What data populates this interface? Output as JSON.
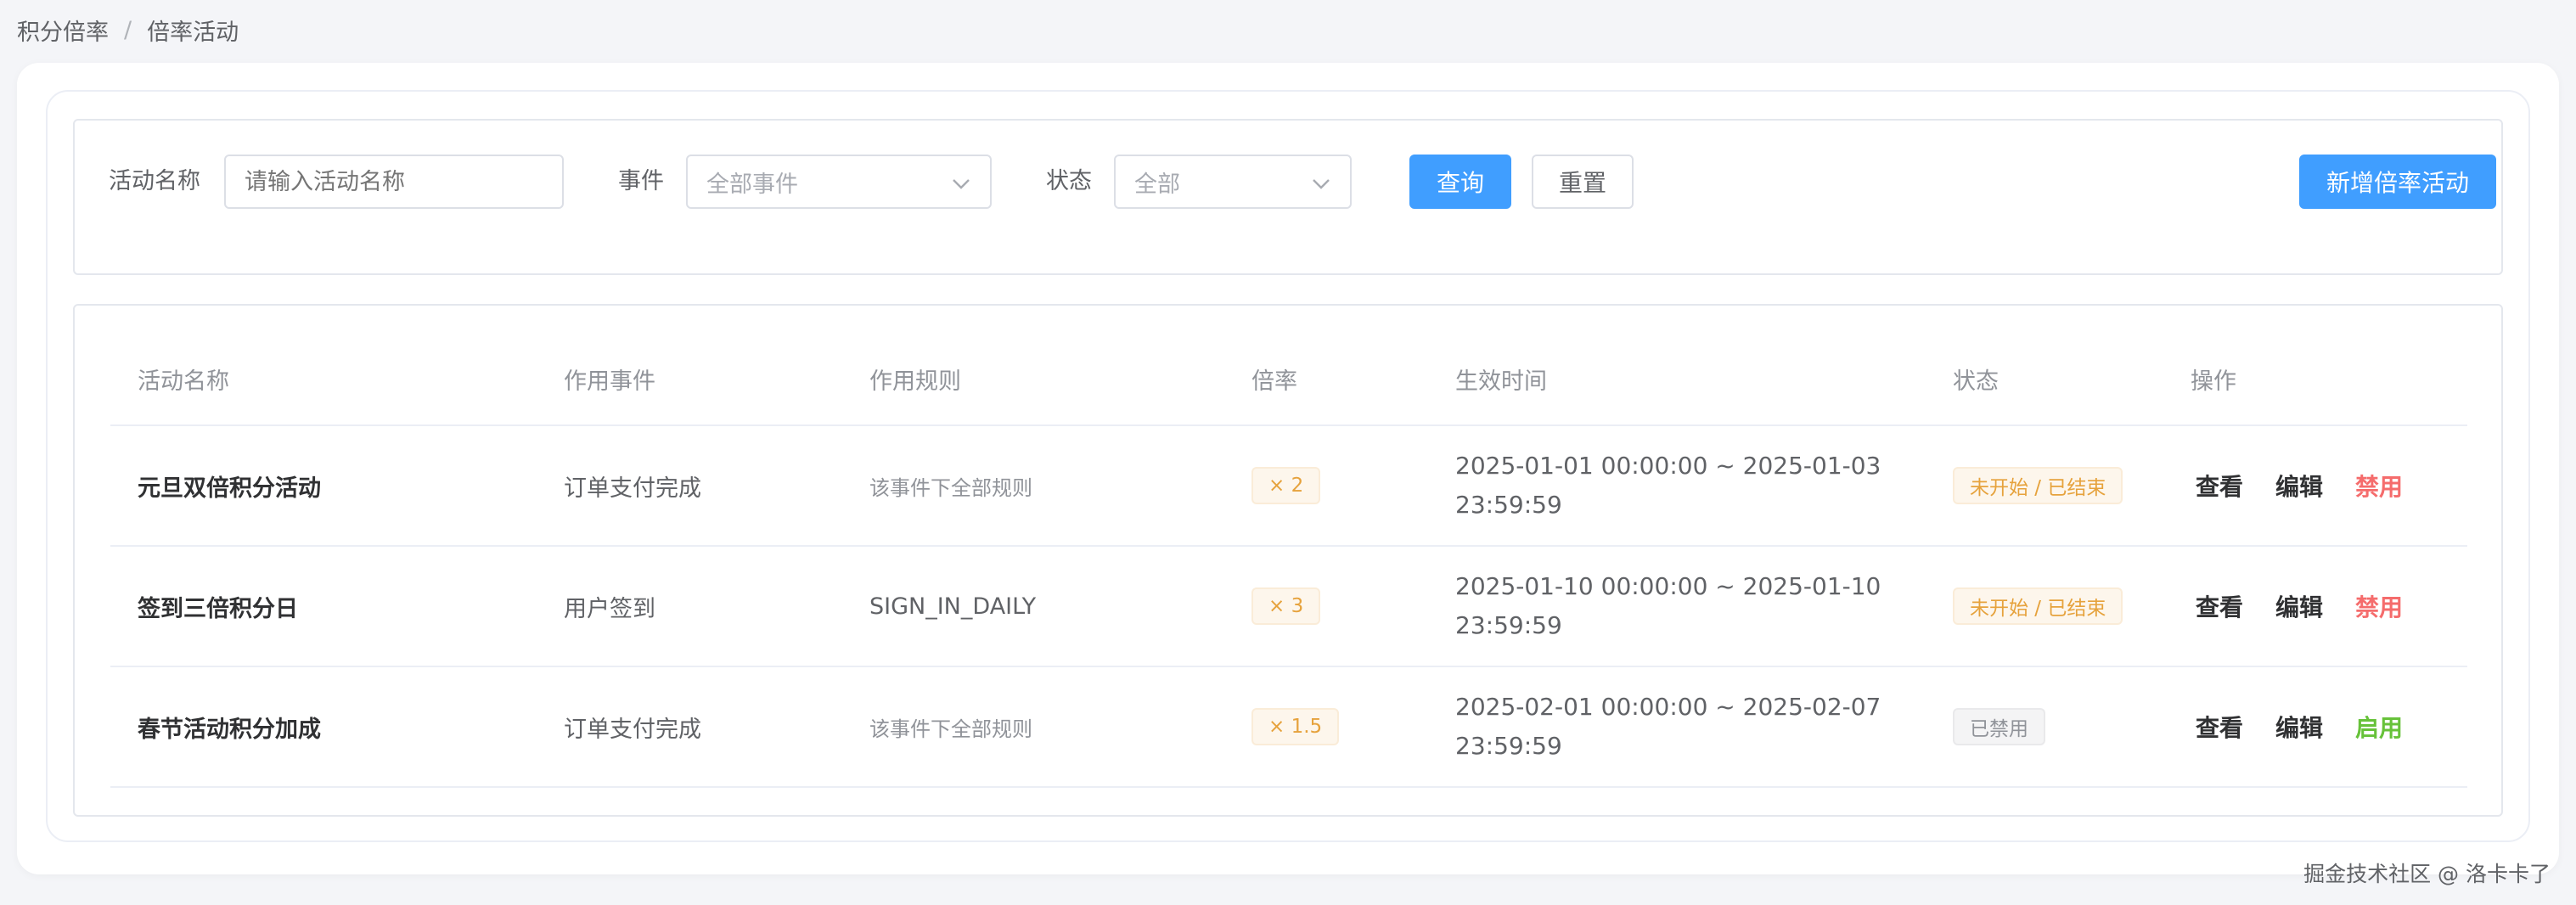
{
  "breadcrumb": {
    "items": [
      "积分倍率",
      "倍率活动"
    ],
    "separator": "/"
  },
  "filters": {
    "name_label": "活动名称",
    "name_placeholder": "请输入活动名称",
    "event_label": "事件",
    "event_value": "全部事件",
    "status_label": "状态",
    "status_value": "全部",
    "query_label": "查询",
    "reset_label": "重置",
    "add_label": "新增倍率活动"
  },
  "table": {
    "headers": [
      "活动名称",
      "作用事件",
      "作用规则",
      "倍率",
      "生效时间",
      "状态",
      "操作"
    ],
    "rows": [
      {
        "name": "元旦双倍积分活动",
        "event": "订单支付完成",
        "rule": "该事件下全部规则",
        "rate": "× 2",
        "time": "2025-01-01 00:00:00 ~ 2025-01-03 23:59:59",
        "status": "未开始 / 已结束",
        "actions": [
          "查看",
          "编辑",
          "禁用"
        ]
      },
      {
        "name": "签到三倍积分日",
        "event": "用户签到",
        "rule": "SIGN_IN_DAILY",
        "rate": "× 3",
        "time": "2025-01-10 00:00:00 ~ 2025-01-10 23:59:59",
        "status": "未开始 / 已结束",
        "actions": [
          "查看",
          "编辑",
          "禁用"
        ]
      },
      {
        "name": "春节活动积分加成",
        "event": "订单支付完成",
        "rule": "该事件下全部规则",
        "rate": "× 1.5",
        "time": "2025-02-01 00:00:00 ~ 2025-02-07 23:59:59",
        "status": "已禁用",
        "actions": [
          "查看",
          "编辑",
          "启用"
        ]
      }
    ]
  },
  "watermark": "掘金技术社区 @ 洛卡卡了",
  "colors": {
    "primary": "#409eff",
    "danger": "#f56c6c",
    "success": "#67c23a",
    "warning": "#e6a23c"
  }
}
